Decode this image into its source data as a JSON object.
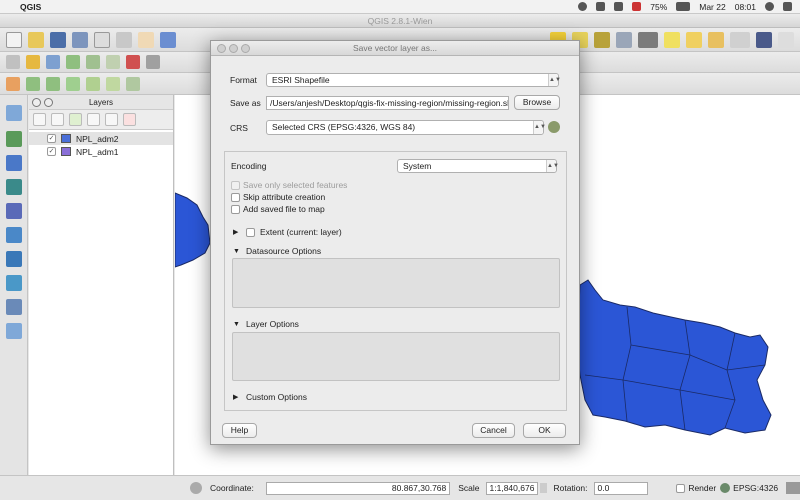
{
  "menubar": {
    "apple": "",
    "app_name": "QGIS",
    "battery": "75%",
    "date": "Mar 22",
    "time": "08:01",
    "icons": [
      "skype-icon",
      "wifi-icon",
      "volume-icon",
      "flag-us-icon",
      "battery-icon",
      "search-icon",
      "list-icon"
    ]
  },
  "window": {
    "title": "QGIS 2.8.1-Wien"
  },
  "layers_panel": {
    "title": "Layers",
    "layers": [
      {
        "name": "NPL_adm2",
        "checked": true,
        "color": "#4a6fd8",
        "selected": true
      },
      {
        "name": "NPL_adm1",
        "checked": true,
        "color": "#8a6fd8",
        "selected": false
      }
    ],
    "check_mark": "✓"
  },
  "dialog": {
    "title": "Save vector layer as...",
    "format_label": "Format",
    "format_value": "ESRI Shapefile",
    "save_as_label": "Save as",
    "save_as_value": "/Users/anjesh/Desktop/qgis-fix-missing-region/missing-region.shp",
    "browse_label": "Browse",
    "crs_label": "CRS",
    "crs_value": "Selected CRS (EPSG:4326, WGS 84)",
    "encoding_label": "Encoding",
    "encoding_value": "System",
    "save_selected_label": "Save only selected features",
    "skip_attr_label": "Skip attribute creation",
    "add_to_map_label": "Add saved file to map",
    "extent_label": "Extent (current: layer)",
    "datasource_label": "Datasource Options",
    "layer_options_label": "Layer Options",
    "custom_options_label": "Custom Options",
    "help_label": "Help",
    "cancel_label": "Cancel",
    "ok_label": "OK"
  },
  "statusbar": {
    "coordinate_label": "Coordinate:",
    "coordinate_value": "80.867,30.768",
    "scale_label": "Scale",
    "scale_value": "1:1,840,676",
    "rotation_label": "Rotation:",
    "rotation_value": "0.0",
    "render_label": "Render",
    "crs_label": "EPSG:4326"
  },
  "colors": {
    "map_fill": "#2b56d6",
    "map_stroke": "#1a2a66"
  }
}
